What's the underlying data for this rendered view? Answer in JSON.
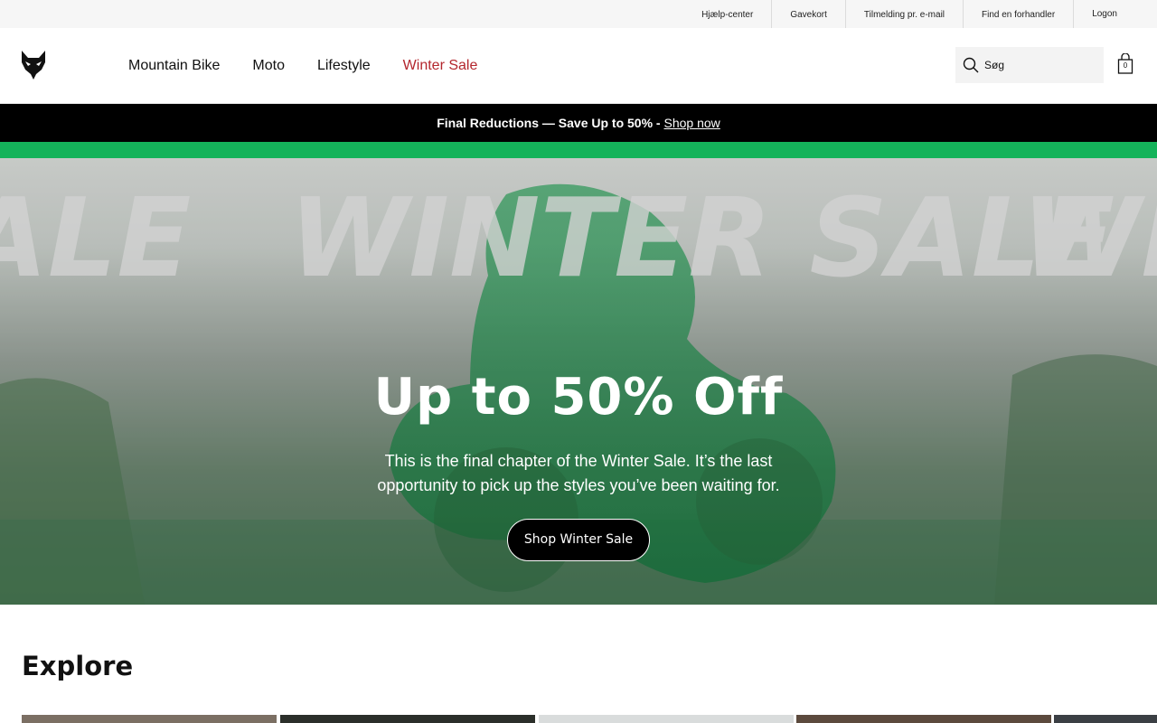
{
  "utility": {
    "links": [
      "Hjælp-center",
      "Gavekort",
      "Tilmelding pr. e-mail",
      "Find en forhandler",
      "Logon"
    ]
  },
  "header": {
    "logo_icon": "fox-head-logo-icon",
    "nav": [
      "Mountain Bike",
      "Moto",
      "Lifestyle",
      "Winter Sale"
    ],
    "sale_color": "#b3262d",
    "search_placeholder": "Søg",
    "cart_count": "0"
  },
  "promo": {
    "text": "Final Reductions — Save Up to 50% -",
    "link": "Shop now"
  },
  "hero": {
    "background_text": "WINTER SALE",
    "heading": "Up to 50% Off",
    "text": "This is the final chapter of the Winter Sale. It’s the last opportunity to pick up the styles you’ve been waiting for.",
    "cta": "Shop Winter Sale",
    "accent_color": "#14b35a"
  },
  "explore": {
    "title": "Explore"
  }
}
